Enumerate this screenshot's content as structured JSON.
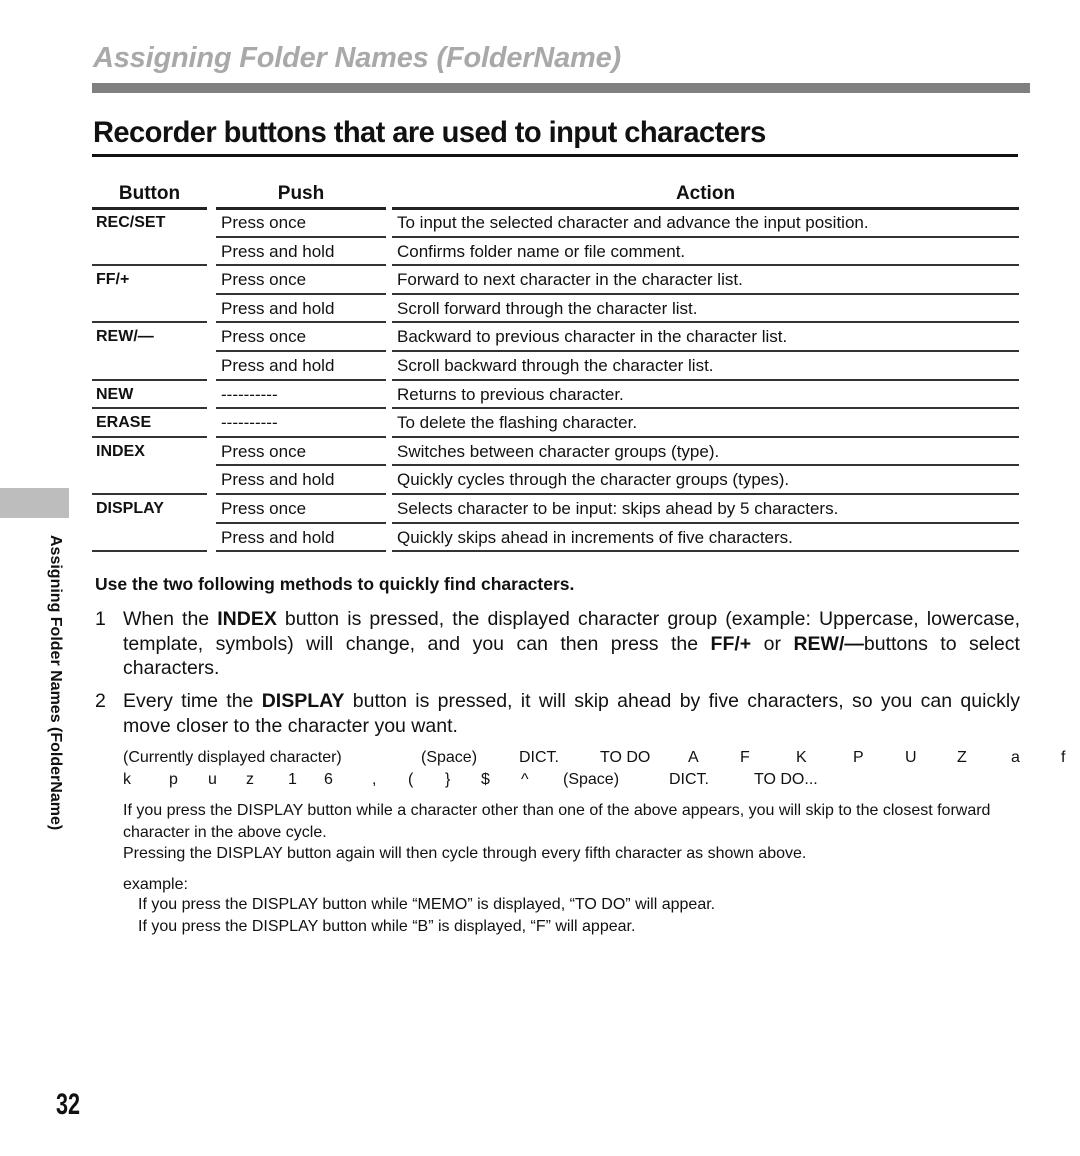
{
  "section_title": "Assigning Folder Names (FolderName)",
  "page_heading": "Recorder buttons that are used to input characters",
  "table": {
    "headers": {
      "button": "Button",
      "push": "Push",
      "action": "Action"
    },
    "rows": [
      {
        "button": "REC/SET",
        "push": "Press once",
        "action": "To input the selected character and advance the input position."
      },
      {
        "button": "",
        "push": "Press and hold",
        "action": "Confirms folder name or file comment."
      },
      {
        "button": "FF/+",
        "push": "Press once",
        "action": "Forward to next character in the character list."
      },
      {
        "button": "",
        "push": "Press and hold",
        "action": "Scroll forward through the character list."
      },
      {
        "button": "REW/—",
        "push": "Press once",
        "action": "Backward to previous character in the character list."
      },
      {
        "button": "",
        "push": "Press and hold",
        "action": "Scroll backward through the character list."
      },
      {
        "button": "NEW",
        "push": "----------",
        "action": "Returns to previous character."
      },
      {
        "button": "ERASE",
        "push": "----------",
        "action": "To delete the flashing character."
      },
      {
        "button": "INDEX",
        "push": "Press once",
        "action": "Switches between character groups (type)."
      },
      {
        "button": "",
        "push": "Press and hold",
        "action": "Quickly cycles through the character groups (types)."
      },
      {
        "button": "DISPLAY",
        "push": "Press once",
        "action": "Selects character to be input: skips ahead by 5 characters."
      },
      {
        "button": "",
        "push": "Press and hold",
        "action": "Quickly skips ahead in increments of five characters."
      }
    ]
  },
  "methods": {
    "heading": "Use the two following methods to quickly find characters.",
    "items": [
      {
        "number": "1",
        "parts": [
          "When the ",
          "INDEX",
          " button is pressed, the displayed character group (example: Uppercase, lowercase, template, symbols) will change, and you can then press the ",
          "FF/+",
          " or ",
          "REW/—",
          "buttons to select characters."
        ]
      },
      {
        "number": "2",
        "parts": [
          "Every time the ",
          "DISPLAY",
          " button is pressed, it will skip ahead by five characters, so you can quickly move closer to the character you want."
        ]
      }
    ],
    "cycle_line1": [
      "(Currently displayed character)",
      "(Space)",
      "DICT.",
      "TO DO",
      "A",
      "F",
      "K",
      "P",
      "U",
      "Z",
      "a",
      "f"
    ],
    "cycle_line2": [
      "k",
      "p",
      "u",
      "z",
      "1",
      "6",
      ",",
      "(",
      "}",
      "$",
      "^",
      "(Space)",
      "DICT.",
      "TO DO..."
    ],
    "note1": "If you press the DISPLAY button while a character other than one of the above appears, you will skip to the closest forward character in the above cycle.",
    "note2": "Pressing the DISPLAY button again will then cycle through every fifth character as shown above.",
    "example_label": "example:",
    "example_lines": [
      "If you press the DISPLAY button while “MEMO” is displayed, “TO DO” will appear.",
      "If you press the DISPLAY button while “B” is displayed, “F” will appear."
    ]
  },
  "side_label": "Assigning Folder Names (FolderName)",
  "page_number": "32"
}
